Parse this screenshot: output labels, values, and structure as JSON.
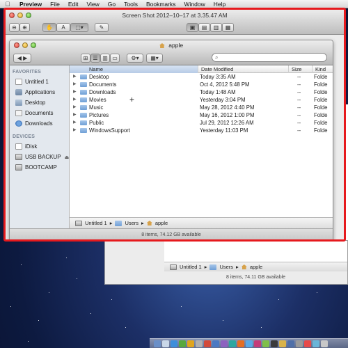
{
  "menubar": {
    "app_name": "Preview",
    "items": [
      "File",
      "Edit",
      "View",
      "Go",
      "Tools",
      "Bookmarks",
      "Window",
      "Help"
    ]
  },
  "preview_window": {
    "title": "Screen Shot 2012–10–17 at 3.35.47 AM",
    "toolbar_icons": [
      "zoom-out-icon",
      "zoom-in-icon",
      "hand-icon",
      "text-select-icon",
      "rect-select-icon",
      "annotate-icon",
      "single-page-icon",
      "two-page-icon",
      "thumbnail-icon",
      "sidebar-icon"
    ],
    "accent_border": "#e6191d"
  },
  "finder": {
    "title": "apple",
    "search_placeholder": "",
    "sidebar": {
      "favorites_header": "FAVORITES",
      "favorites": [
        "Untitled 1",
        "Applications",
        "Desktop",
        "Documents",
        "Downloads"
      ],
      "devices_header": "DEVICES",
      "devices": [
        "iDisk",
        "USB BACKUP",
        "BOOTCAMP"
      ]
    },
    "columns": {
      "name": "Name",
      "date": "Date Modified",
      "size": "Size",
      "kind": "Kind"
    },
    "rows": [
      {
        "name": "Desktop",
        "date": "Today 3:35 AM",
        "size": "--",
        "kind": "Folde"
      },
      {
        "name": "Documents",
        "date": "Oct 4, 2012 5:48 PM",
        "size": "--",
        "kind": "Folde"
      },
      {
        "name": "Downloads",
        "date": "Today 1:48 AM",
        "size": "--",
        "kind": "Folde"
      },
      {
        "name": "Movies",
        "date": "Yesterday 3:04 PM",
        "size": "--",
        "kind": "Folde"
      },
      {
        "name": "Music",
        "date": "May 28, 2012 4:40 PM",
        "size": "--",
        "kind": "Folde"
      },
      {
        "name": "Pictures",
        "date": "May 16, 2012 1:00 PM",
        "size": "--",
        "kind": "Folde"
      },
      {
        "name": "Public",
        "date": "Jul 29, 2012 12:26 AM",
        "size": "--",
        "kind": "Folde"
      },
      {
        "name": "WindowsSupport",
        "date": "Yesterday 11:03 PM",
        "size": "--",
        "kind": "Folde"
      }
    ],
    "path": [
      "Untitled 1",
      "Users",
      "apple"
    ],
    "status": "8 items, 74.12 GB available"
  },
  "background_window": {
    "path": [
      "Untitled 1",
      "Users",
      "apple"
    ],
    "status": "8 items, 74.11 GB available"
  }
}
